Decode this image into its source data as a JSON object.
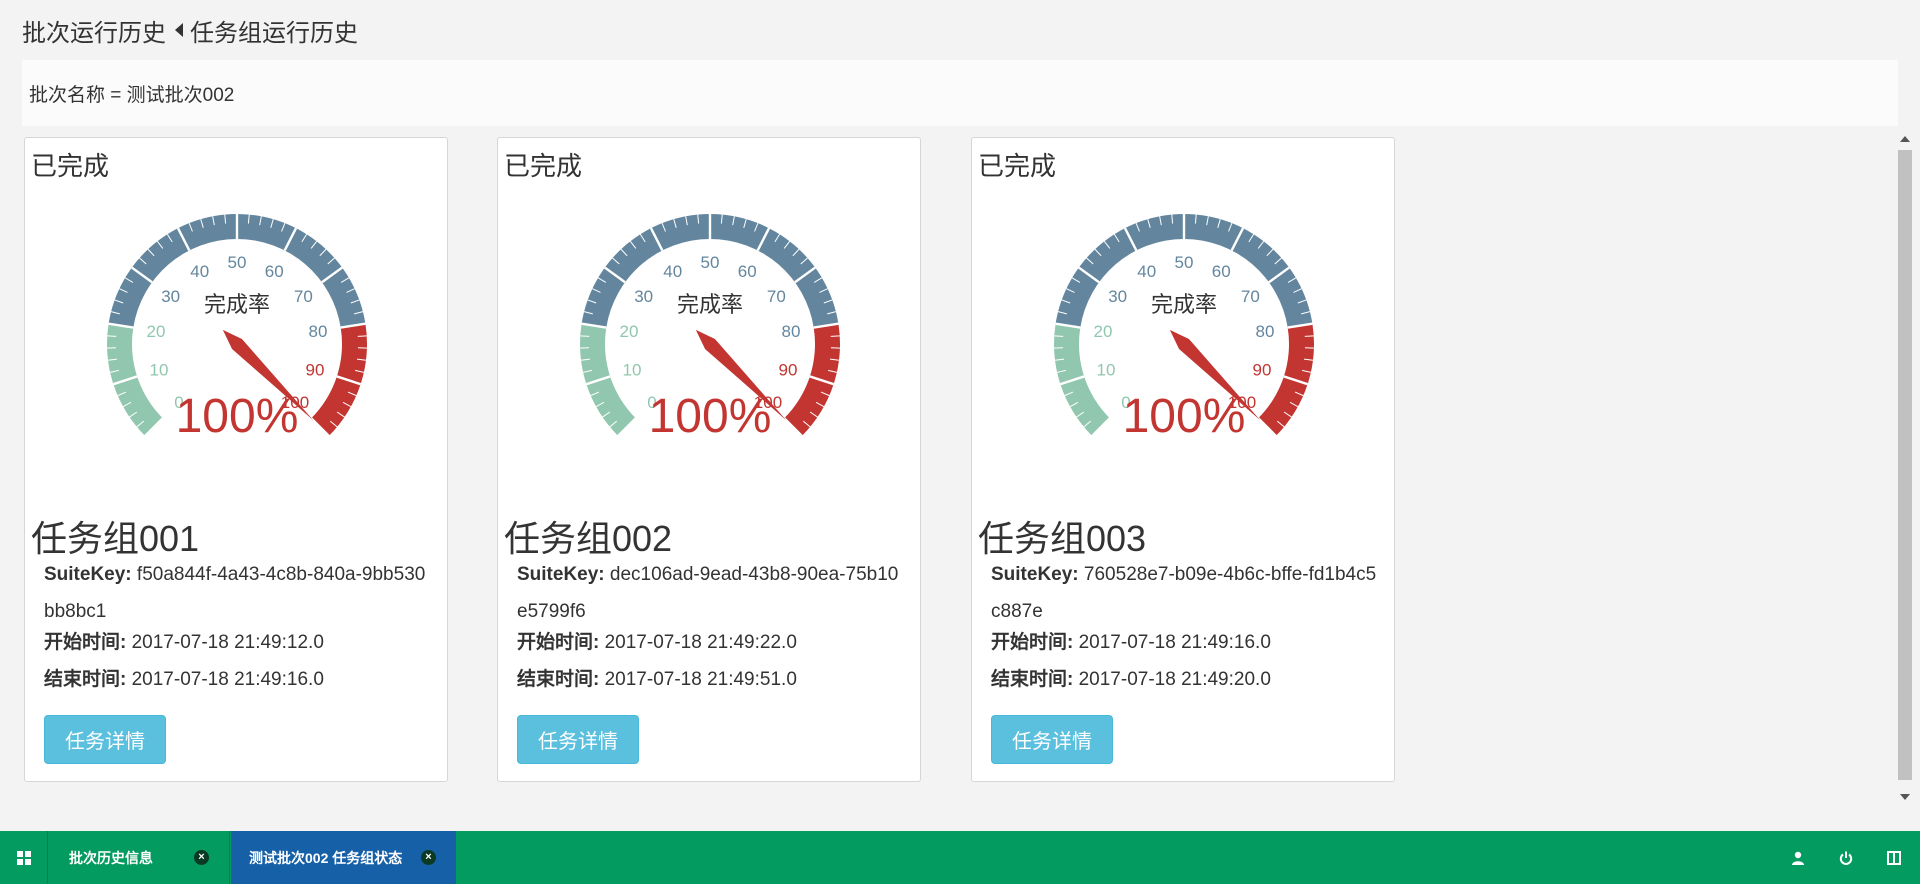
{
  "breadcrumb": {
    "parent": "批次运行历史",
    "current": "任务组运行历史"
  },
  "filter": {
    "text": "批次名称 = 测试批次002"
  },
  "gauge_labels": {
    "title": "完成率",
    "ticks": [
      "0",
      "10",
      "20",
      "30",
      "40",
      "50",
      "60",
      "70",
      "80",
      "90",
      "100"
    ]
  },
  "cards": [
    {
      "status": "已完成",
      "progress": 100,
      "progress_text": "100%",
      "name": "任务组001",
      "suitekey_label": "SuiteKey:",
      "suitekey": "f50a844f-4a43-4c8b-840a-9bb530bb8bc1",
      "start_label": "开始时间:",
      "start": "2017-07-18 21:49:12.0",
      "end_label": "结束时间:",
      "end": "2017-07-18 21:49:16.0",
      "button": "任务详情"
    },
    {
      "status": "已完成",
      "progress": 100,
      "progress_text": "100%",
      "name": "任务组002",
      "suitekey_label": "SuiteKey:",
      "suitekey": "dec106ad-9ead-43b8-90ea-75b10e5799f6",
      "start_label": "开始时间:",
      "start": "2017-07-18 21:49:22.0",
      "end_label": "结束时间:",
      "end": "2017-07-18 21:49:51.0",
      "button": "任务详情"
    },
    {
      "status": "已完成",
      "progress": 100,
      "progress_text": "100%",
      "name": "任务组003",
      "suitekey_label": "SuiteKey:",
      "suitekey": "760528e7-b09e-4b6c-bffe-fd1b4c5c887e",
      "start_label": "开始时间:",
      "start": "2017-07-18 21:49:16.0",
      "end_label": "结束时间:",
      "end": "2017-07-18 21:49:20.0",
      "button": "任务详情"
    }
  ],
  "taskbar": {
    "tabs": [
      {
        "label": "批次历史信息",
        "active": false
      },
      {
        "label": "测试批次002 任务组状态",
        "active": true
      }
    ],
    "icons": [
      "windows-icon",
      "user-icon",
      "power-icon",
      "layout-icon"
    ]
  },
  "colors": {
    "gauge_low": "#91c7ae",
    "gauge_mid": "#63869e",
    "gauge_high": "#c23531",
    "button": "#5bc0de",
    "taskbar": "#039b5f",
    "taskbar_active": "#1660a8"
  }
}
